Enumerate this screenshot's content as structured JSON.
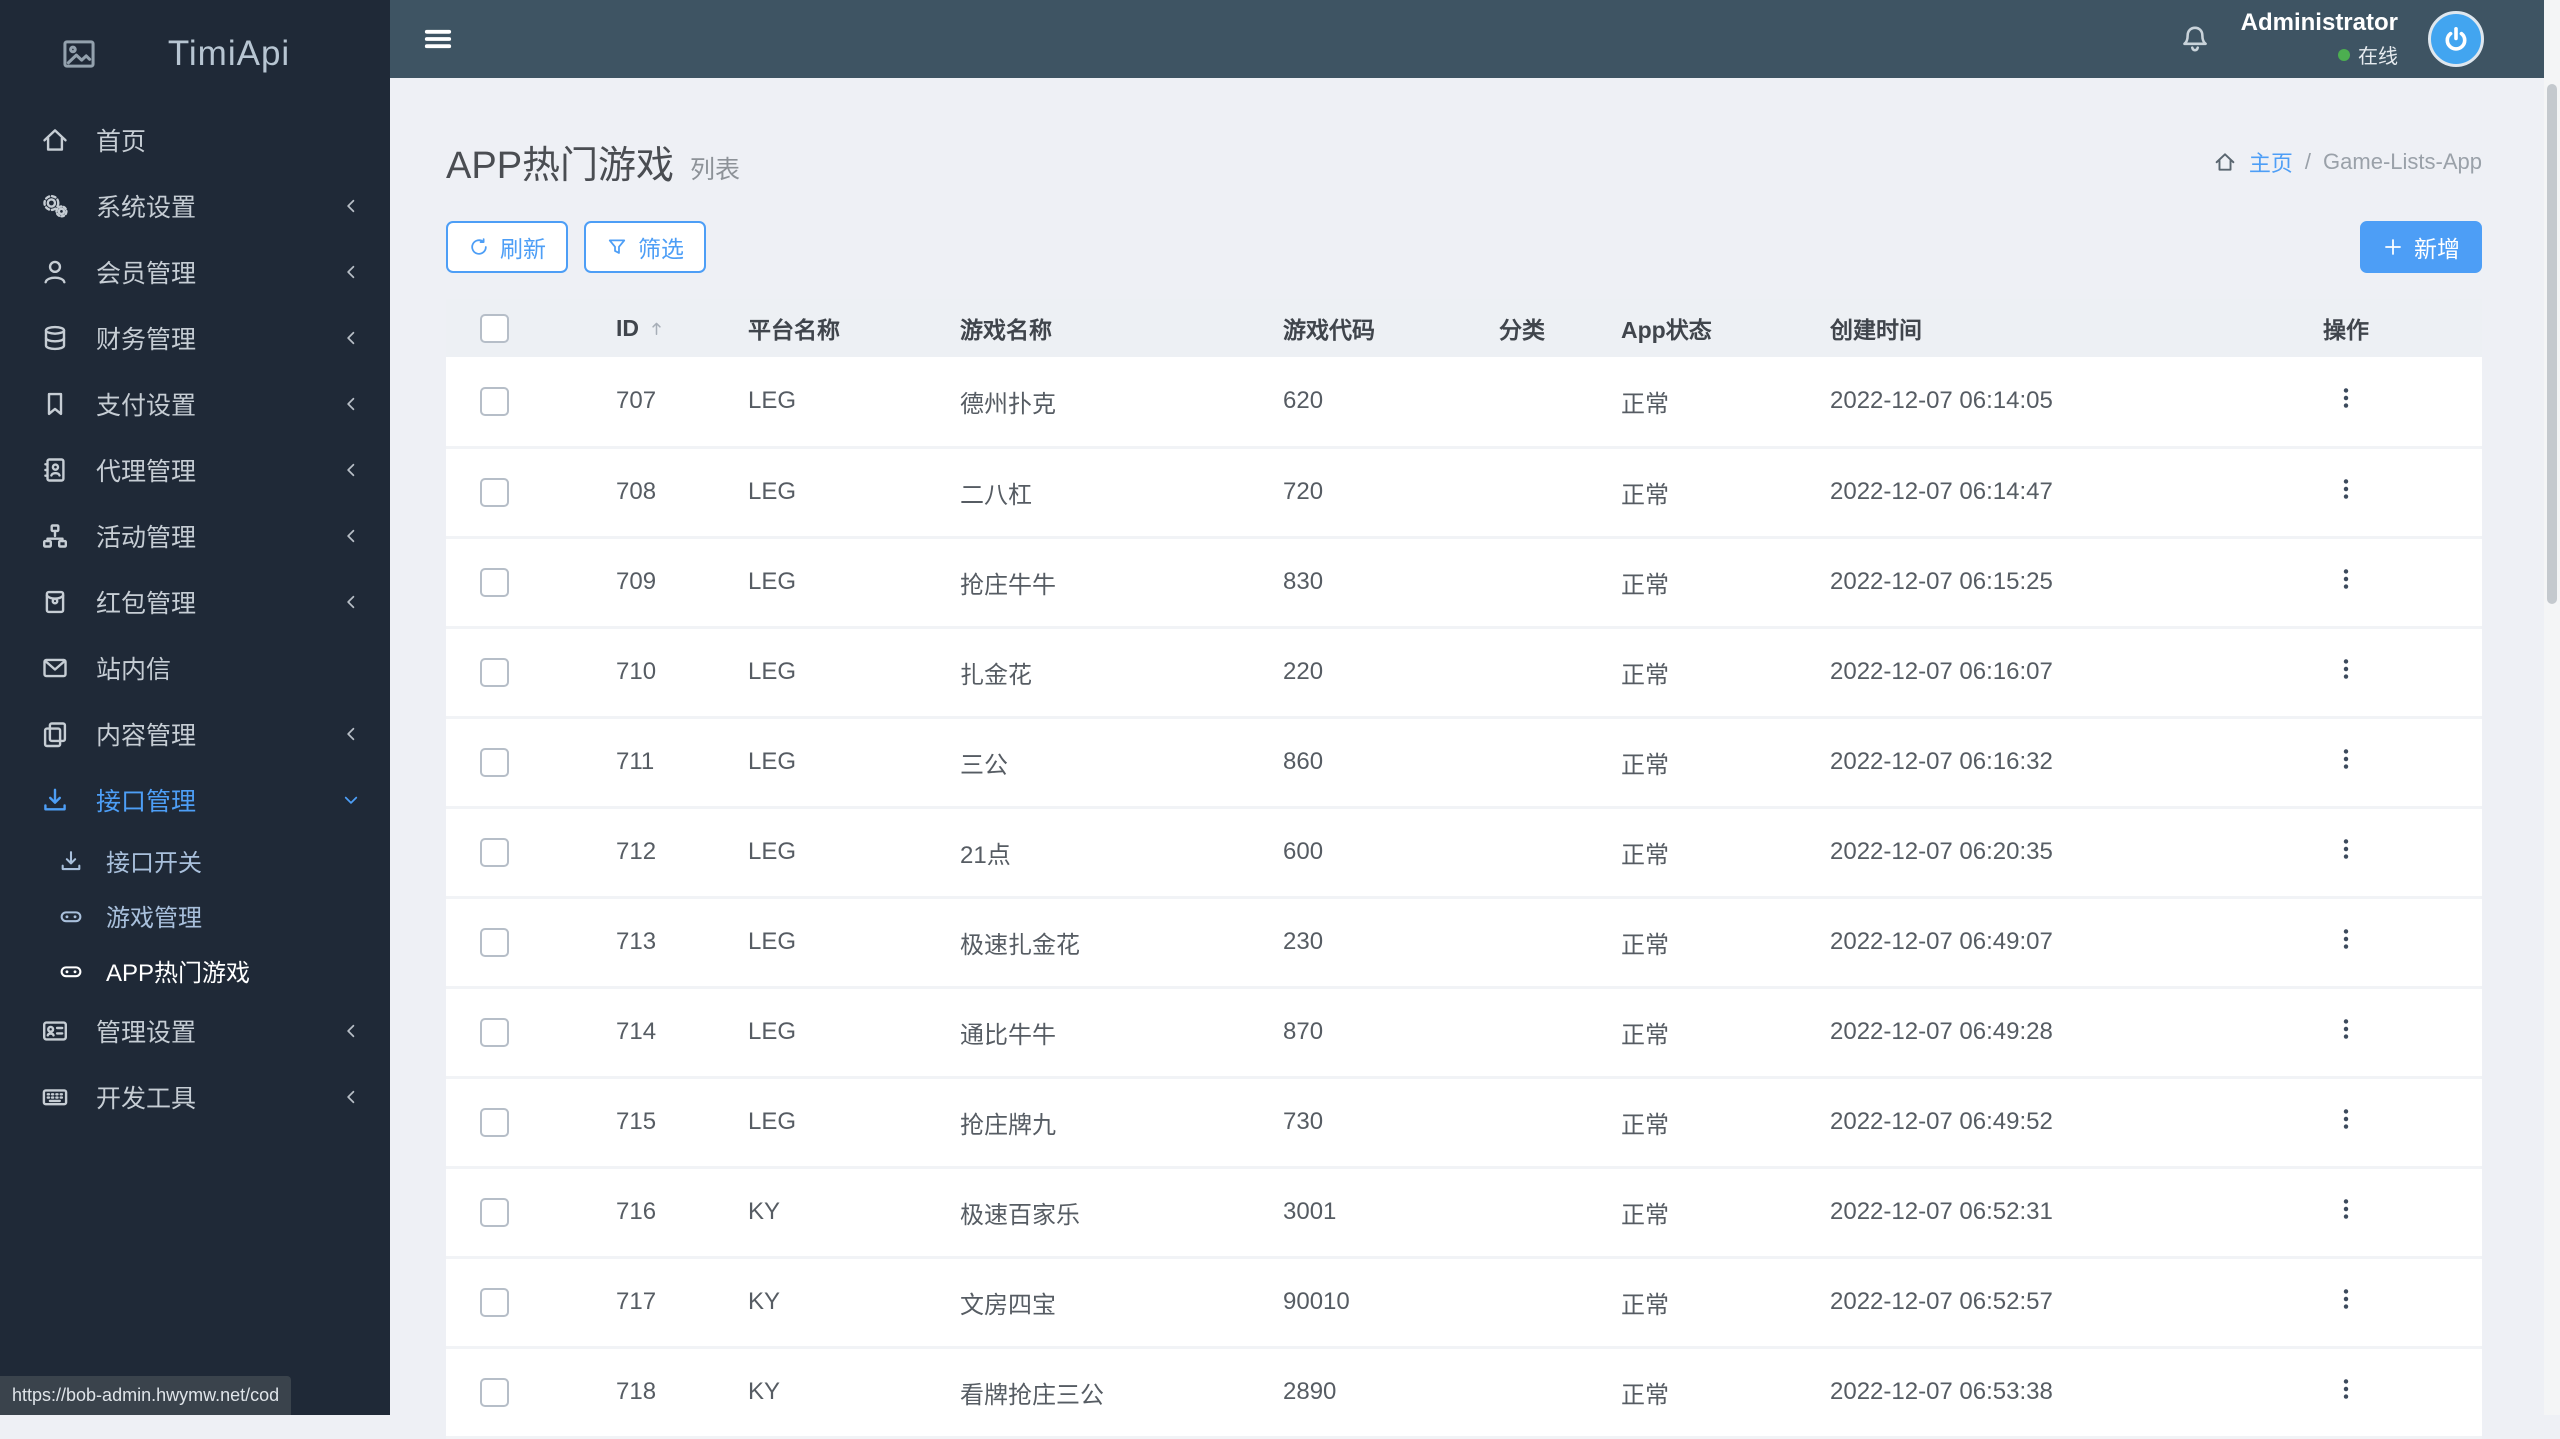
{
  "app": {
    "logo_text": "TimiApi"
  },
  "topbar": {
    "user_name": "Administrator",
    "user_status": "在线"
  },
  "sidebar": {
    "items": [
      {
        "label": "首页",
        "icon": "home-icon"
      },
      {
        "label": "系统设置",
        "icon": "cogs-icon"
      },
      {
        "label": "会员管理",
        "icon": "user-icon"
      },
      {
        "label": "财务管理",
        "icon": "database-icon"
      },
      {
        "label": "支付设置",
        "icon": "bookmark-icon"
      },
      {
        "label": "代理管理",
        "icon": "address-book-icon"
      },
      {
        "label": "活动管理",
        "icon": "sitemap-icon"
      },
      {
        "label": "红包管理",
        "icon": "red-packet-icon"
      },
      {
        "label": "站内信",
        "icon": "envelope-icon"
      },
      {
        "label": "内容管理",
        "icon": "copy-icon"
      },
      {
        "label": "接口管理",
        "icon": "download-icon",
        "children": [
          {
            "label": "接口开关",
            "icon": "download-icon"
          },
          {
            "label": "游戏管理",
            "icon": "gamepad-icon"
          },
          {
            "label": "APP热门游戏",
            "icon": "gamepad-icon"
          }
        ]
      },
      {
        "label": "管理设置",
        "icon": "id-card-icon"
      },
      {
        "label": "开发工具",
        "icon": "keyboard-icon"
      }
    ]
  },
  "page": {
    "title": "APP热门游戏",
    "subtitle": "列表",
    "breadcrumb": {
      "home": "主页",
      "separator": "/",
      "current": "Game-Lists-App"
    }
  },
  "toolbar": {
    "refresh_label": "刷新",
    "filter_label": "筛选",
    "add_label": "新增"
  },
  "table": {
    "headers": [
      "ID",
      "平台名称",
      "游戏名称",
      "游戏代码",
      "分类",
      "App状态",
      "创建时间",
      "操作"
    ],
    "rows": [
      {
        "id": "707",
        "platform": "LEG",
        "name": "德州扑克",
        "code": "620",
        "category": "",
        "status": "正常",
        "created": "2022-12-07 06:14:05"
      },
      {
        "id": "708",
        "platform": "LEG",
        "name": "二八杠",
        "code": "720",
        "category": "",
        "status": "正常",
        "created": "2022-12-07 06:14:47"
      },
      {
        "id": "709",
        "platform": "LEG",
        "name": "抢庄牛牛",
        "code": "830",
        "category": "",
        "status": "正常",
        "created": "2022-12-07 06:15:25"
      },
      {
        "id": "710",
        "platform": "LEG",
        "name": "扎金花",
        "code": "220",
        "category": "",
        "status": "正常",
        "created": "2022-12-07 06:16:07"
      },
      {
        "id": "711",
        "platform": "LEG",
        "name": "三公",
        "code": "860",
        "category": "",
        "status": "正常",
        "created": "2022-12-07 06:16:32"
      },
      {
        "id": "712",
        "platform": "LEG",
        "name": "21点",
        "code": "600",
        "category": "",
        "status": "正常",
        "created": "2022-12-07 06:20:35"
      },
      {
        "id": "713",
        "platform": "LEG",
        "name": "极速扎金花",
        "code": "230",
        "category": "",
        "status": "正常",
        "created": "2022-12-07 06:49:07"
      },
      {
        "id": "714",
        "platform": "LEG",
        "name": "通比牛牛",
        "code": "870",
        "category": "",
        "status": "正常",
        "created": "2022-12-07 06:49:28"
      },
      {
        "id": "715",
        "platform": "LEG",
        "name": "抢庄牌九",
        "code": "730",
        "category": "",
        "status": "正常",
        "created": "2022-12-07 06:49:52"
      },
      {
        "id": "716",
        "platform": "KY",
        "name": "极速百家乐",
        "code": "3001",
        "category": "",
        "status": "正常",
        "created": "2022-12-07 06:52:31"
      },
      {
        "id": "717",
        "platform": "KY",
        "name": "文房四宝",
        "code": "90010",
        "category": "",
        "status": "正常",
        "created": "2022-12-07 06:52:57"
      },
      {
        "id": "718",
        "platform": "KY",
        "name": "看牌抢庄三公",
        "code": "2890",
        "category": "",
        "status": "正常",
        "created": "2022-12-07 06:53:38"
      }
    ]
  },
  "statusbar": {
    "link": "https://bob-admin.hwymw.net/cod"
  },
  "colors": {
    "accent": "#4d9ef6",
    "topbar": "#3e5463",
    "sidebar": "#1f2937",
    "online": "#4caf50"
  }
}
